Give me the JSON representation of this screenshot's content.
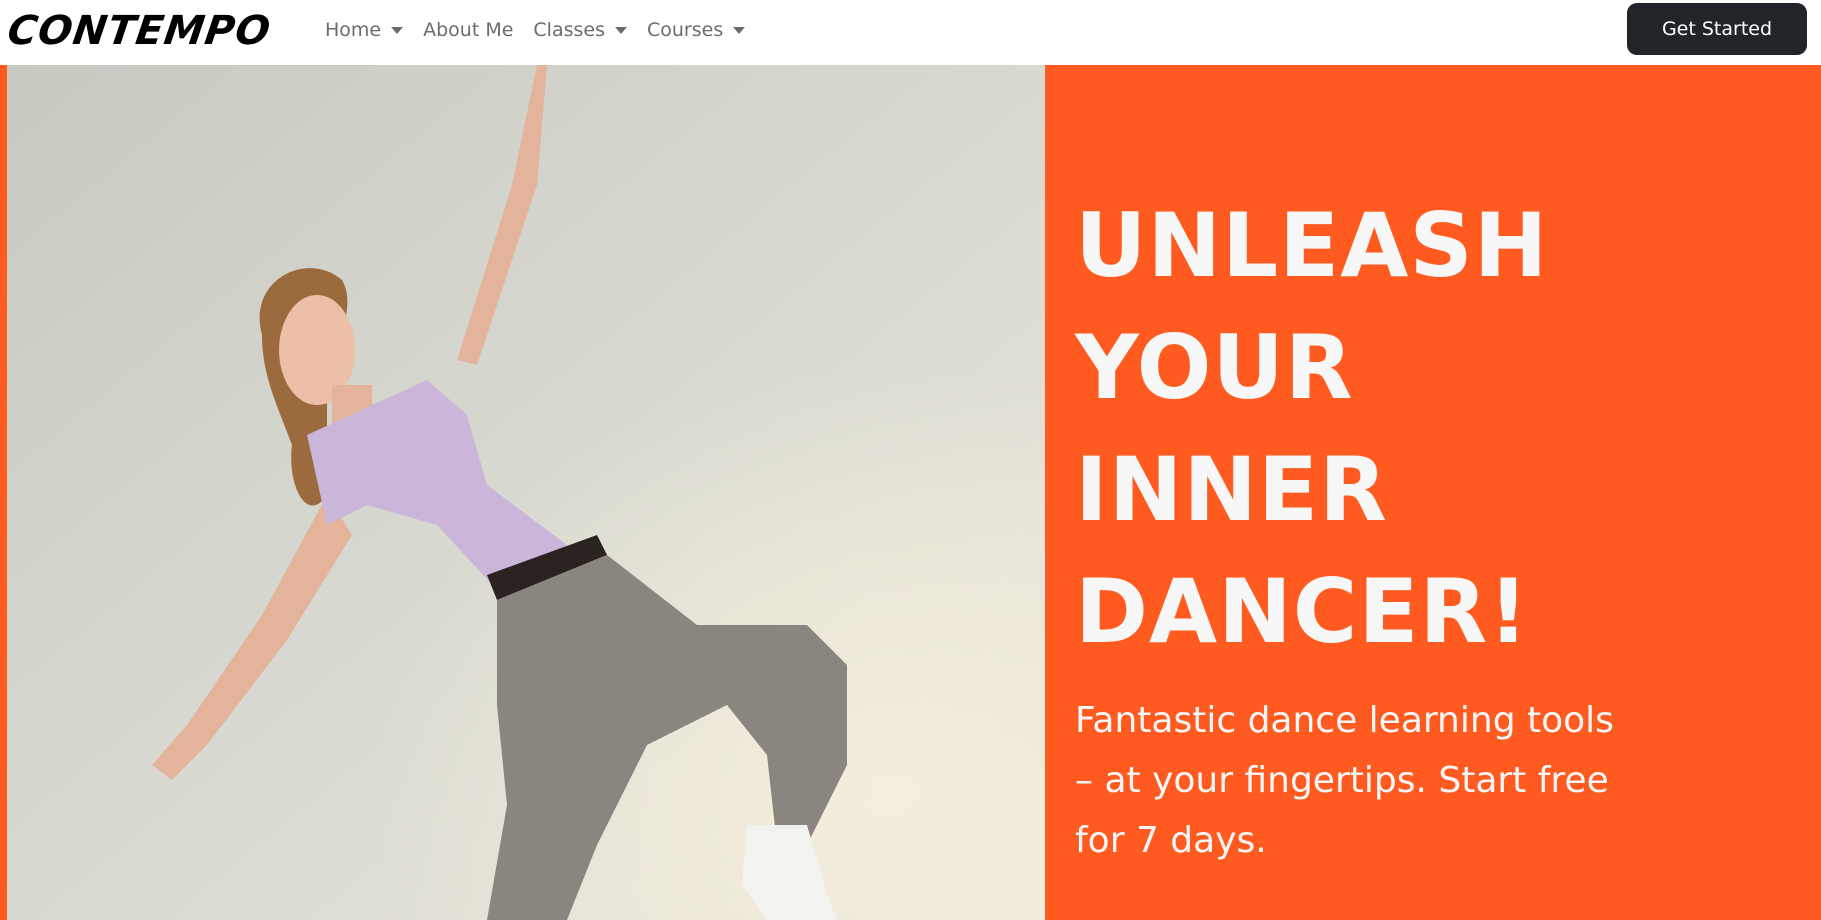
{
  "brand": {
    "logo_text": "CONTEMPO"
  },
  "nav": {
    "items": [
      {
        "label": "Home",
        "dropdown": true
      },
      {
        "label": "About Me",
        "dropdown": false
      },
      {
        "label": "Classes",
        "dropdown": true
      },
      {
        "label": "Courses",
        "dropdown": true
      }
    ],
    "cta_label": "Get Started"
  },
  "hero": {
    "headline_lines": [
      "UNLEASH",
      "YOUR",
      "INNER",
      "DANCER!"
    ],
    "subtext": "Fantastic dance learning tools – at your fingertips. Start free for 7 days.",
    "image_icon": "dancer-photo"
  },
  "colors": {
    "accent": "#ff5a1f",
    "button_bg": "#21252a",
    "nav_text": "#6c6c6c",
    "hero_text": "#f7f7f7"
  }
}
